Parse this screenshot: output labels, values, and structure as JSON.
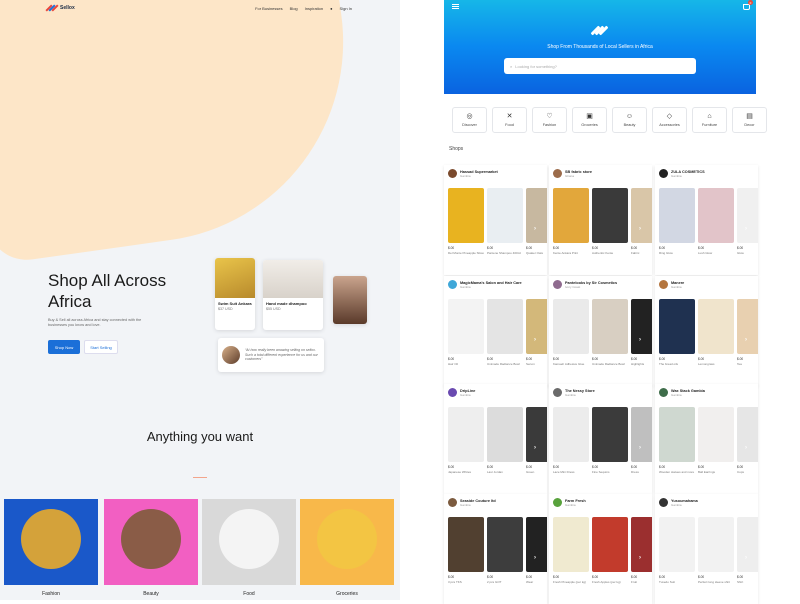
{
  "landing": {
    "brand": "Sellox",
    "nav": [
      "For Businesses",
      "Blog",
      "Inspiration",
      "Sign In"
    ],
    "hero_title": "Shop All Across Africa",
    "hero_text": "Buy & Sell all across Africa and stay connected with the businesses you know and love.",
    "shop_now": "Shop Now",
    "start_selling": "Start Selling",
    "product_cards": [
      {
        "title": "Swim Suit Ankara",
        "price": "$37 USD"
      },
      {
        "title": "Hand made dhampoo",
        "price": "$55 USD"
      }
    ],
    "testimonial": "“At how really been amazing selling on sellox. Such a total different experience for us and our customers”",
    "section_title": "Anything you want",
    "categories": [
      {
        "label": "Fashion",
        "bg": "#1a58c9",
        "circle": "#d4a23a"
      },
      {
        "label": "Beauty",
        "bg": "#f25fc2",
        "circle": "#8a5c47"
      },
      {
        "label": "Food",
        "bg": "#d9d9d9",
        "circle": "#f4f4f4"
      },
      {
        "label": "Groceries",
        "bg": "#f8b84a",
        "circle": "#f3c543"
      }
    ]
  },
  "app": {
    "tagline": "Shop From Thousands of Local Sellers in Africa",
    "search_placeholder": "Looking for something?",
    "cart_count": "0",
    "tabs": [
      {
        "label": "Discover",
        "icon": "◎"
      },
      {
        "label": "Food",
        "icon": "✕"
      },
      {
        "label": "Fashion",
        "icon": "♡"
      },
      {
        "label": "Groceries",
        "icon": "▣"
      },
      {
        "label": "Beauty",
        "icon": "☺"
      },
      {
        "label": "Accessories",
        "icon": "◇"
      },
      {
        "label": "Furniture",
        "icon": "⌂"
      },
      {
        "label": "Decor",
        "icon": "▤"
      }
    ],
    "shops_heading": "Shops",
    "shops": [
      {
        "name": "Hassad Supermarket",
        "sub": "Gambia",
        "av": "#7b4a2d",
        "prods": [
          {
            "price": "$.00",
            "name": "Del Monte Pineapple Sliced",
            "c": "#e8b320"
          },
          {
            "price": "$.00",
            "name": "Pantene Shampoo 400ml",
            "c": "#e9eef2"
          },
          {
            "price": "$.00",
            "name": "Quaker Oats",
            "c": "#c7b8a0"
          }
        ]
      },
      {
        "name": "SB fabric store",
        "sub": "Ghana",
        "av": "#9b6b4a",
        "prods": [
          {
            "price": "$.00",
            "name": "Kente Ankara Print",
            "c": "#e2a73b"
          },
          {
            "price": "$.00",
            "name": "Authentic Kente",
            "c": "#3a3a3a"
          },
          {
            "price": "$.00",
            "name": "Fabric",
            "c": "#d9c6a8"
          }
        ]
      },
      {
        "name": "ZULA COSMETICS",
        "sub": "Gambia",
        "av": "#222222",
        "prods": [
          {
            "price": "$.00",
            "name": "Ring Glow",
            "c": "#d2d7e3"
          },
          {
            "price": "$.00",
            "name": "Lush Glow",
            "c": "#e2c4c9"
          },
          {
            "price": "$.00",
            "name": "Glow",
            "c": "#f0f0f0"
          }
        ]
      },
      {
        "name": "MagicMama's Salon and Hair Care",
        "sub": "Gambia",
        "av": "#3fa7d8",
        "prods": [
          {
            "price": "$.00",
            "name": "Hair Oil",
            "c": "#f3f3f3"
          },
          {
            "price": "$.00",
            "name": "Unimade Radiance Bowl",
            "c": "#e4e4e4"
          },
          {
            "price": "$.00",
            "name": "Serum",
            "c": "#d3b87a"
          }
        ]
      },
      {
        "name": "Pantelooks by Sir Cosmetics",
        "sub": "Ivory Coast",
        "av": "#8f6b8f",
        "prods": [
          {
            "price": "$.00",
            "name": "Kamaeh Adhesive Glue",
            "c": "#eaeaea"
          },
          {
            "price": "$.00",
            "name": "Unimade Radiance Bowl",
            "c": "#d8cfc2"
          },
          {
            "price": "$.00",
            "name": "Highlights",
            "c": "#222222"
          }
        ]
      },
      {
        "name": "Manere",
        "sub": "Gambia",
        "av": "#b4753e",
        "prods": [
          {
            "price": "$.00",
            "name": "The bread oils",
            "c": "#1f3150"
          },
          {
            "price": "$.00",
            "name": "Lemongrass",
            "c": "#f0e4cc"
          },
          {
            "price": "$.00",
            "name": "Tea",
            "c": "#e8d0b0"
          }
        ]
      },
      {
        "name": "DripLine",
        "sub": "Gambia",
        "av": "#6a4ab0",
        "prods": [
          {
            "price": "$.00",
            "name": "Japanese Whites",
            "c": "#eeeeee"
          },
          {
            "price": "$.00",
            "name": "Lasr Jordan",
            "c": "#dcdcdc"
          },
          {
            "price": "$.00",
            "name": "Green",
            "c": "#3a3a3a"
          }
        ]
      },
      {
        "name": "The Nessy Store",
        "sub": "Gambia",
        "av": "#6a6a6a",
        "prods": [
          {
            "price": "$.00",
            "name": "Lace Mini Dress",
            "c": "#ececec"
          },
          {
            "price": "$.00",
            "name": "Fine Sequins",
            "c": "#3b3b3b"
          },
          {
            "price": "$.00",
            "name": "Dress",
            "c": "#bfbfbf"
          }
        ]
      },
      {
        "name": "Wax Stack Gambia",
        "sub": "Gambia",
        "av": "#3e6d4a",
        "prods": [
          {
            "price": "$.00",
            "name": "Wooden statues and more",
            "c": "#cfd8d0"
          },
          {
            "price": "$.00",
            "name": "Ball Earrings",
            "c": "#f1efee"
          },
          {
            "price": "$.00",
            "name": "Cups",
            "c": "#e6e6e6"
          }
        ]
      },
      {
        "name": "Seaside Couture ltd",
        "sub": "Gambia",
        "av": "#7c5b3f",
        "prods": [
          {
            "price": "$.00",
            "name": "3 pcs TKS",
            "c": "#514030"
          },
          {
            "price": "$.00",
            "name": "2 pcs GOT",
            "c": "#3d3d3d"
          },
          {
            "price": "$.00",
            "name": "Wear",
            "c": "#222222"
          }
        ]
      },
      {
        "name": "Farm Fresh",
        "sub": "Gambia",
        "av": "#58a23c",
        "prods": [
          {
            "price": "$.00",
            "name": "Fresh Pineapple (per kg)",
            "c": "#f0ead0"
          },
          {
            "price": "$.00",
            "name": "Fresh Apples (per kg)",
            "c": "#c23b2c"
          },
          {
            "price": "$.00",
            "name": "Fruit",
            "c": "#9b2f2f"
          }
        ]
      },
      {
        "name": "Yusoumahama",
        "sub": "Gambia",
        "av": "#333333",
        "prods": [
          {
            "price": "$.00",
            "name": "Tuxedo Suit",
            "c": "#f2f2f2"
          },
          {
            "price": "$.00",
            "name": "Perfect long sleeve shirt",
            "c": "#f2f2f2"
          },
          {
            "price": "$.00",
            "name": "Shirt",
            "c": "#eeeeee"
          }
        ]
      }
    ]
  }
}
